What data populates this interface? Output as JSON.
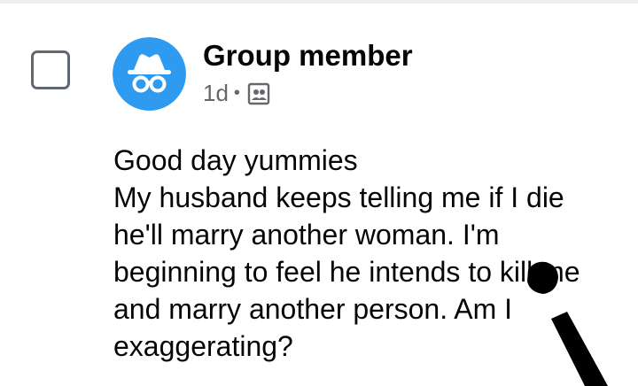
{
  "post": {
    "author": "Group member",
    "time": "1d",
    "separator": "•",
    "audience_icon": "group-members-icon",
    "avatar_icon": "anonymous-incognito-icon",
    "lines": [
      "Good day yummies",
      "My husband keeps telling me if I die",
      "he'll marry another woman. I'm",
      "beginning to feel he intends to kill me",
      "and marry another person. Am I",
      "exaggerating?"
    ]
  },
  "colors": {
    "avatar_bg": "#2f9bf0",
    "text_primary": "#050505",
    "text_secondary": "#65676b",
    "checkbox_border": "#606770",
    "annotation_mark": "#000000"
  }
}
